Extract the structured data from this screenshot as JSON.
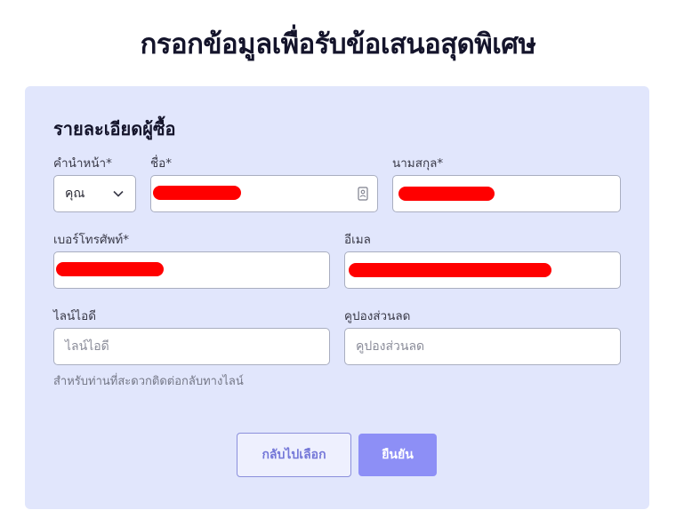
{
  "page": {
    "title": "กรอกข้อมูลเพื่อรับข้อเสนอสุดพิเศษ"
  },
  "form": {
    "section_title": "รายละเอียดผู้ซื้อ",
    "prefix": {
      "label": "คำนำหน้า*",
      "value": "คุณ",
      "icon": "chevron-down-icon"
    },
    "first_name": {
      "label": "ชื่อ*",
      "value_redacted": true,
      "icon": "contact-card-icon"
    },
    "last_name": {
      "label": "นามสกุล*",
      "value_redacted": true
    },
    "phone": {
      "label": "เบอร์โทรศัพท์*",
      "value_redacted": true
    },
    "email": {
      "label": "อีเมล",
      "value_redacted": true
    },
    "line_id": {
      "label": "ไลน์ไอดี",
      "placeholder": "ไลน์ไอดี",
      "helper": "สำหรับท่านที่สะดวกติดต่อกลับทางไลน์"
    },
    "coupon": {
      "label": "คูปองส่วนลด",
      "placeholder": "คูปองส่วนลด"
    }
  },
  "actions": {
    "back_label": "กลับไปเลือก",
    "confirm_label": "ยืนยัน"
  },
  "colors": {
    "card_bg": "#e1e6fc",
    "primary": "#8d8ff6",
    "redaction": "#ff0000"
  }
}
